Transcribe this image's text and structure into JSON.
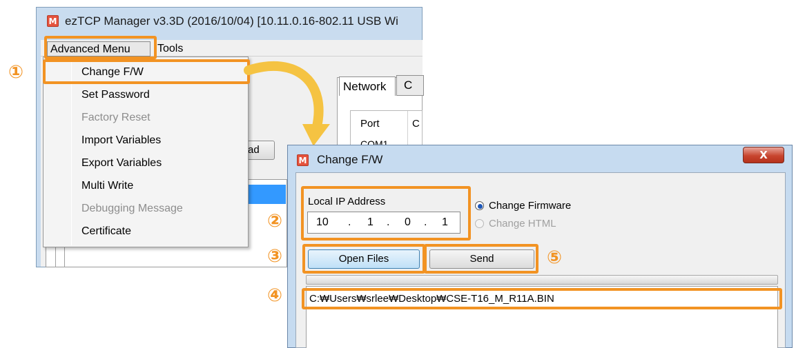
{
  "main_window": {
    "title": "ezTCP Manager v3.3D (2016/10/04) [10.11.0.16-802.11 USB Wi",
    "icon_letter": "M",
    "menu": {
      "advanced": "Advanced Menu",
      "tools": "Tools"
    },
    "tabs": {
      "network": "Network",
      "next_tab_partial": "C"
    },
    "port_column": {
      "header": "Port",
      "header_partial": "C",
      "first_row": "COM1"
    },
    "partial_button": "ad"
  },
  "dropdown_menu": {
    "items": [
      {
        "label": "Change F/W",
        "enabled": true
      },
      {
        "label": "Set Password",
        "enabled": true
      },
      {
        "label": "Factory Reset",
        "enabled": false
      },
      {
        "label": "Import Variables",
        "enabled": true
      },
      {
        "label": "Export Variables",
        "enabled": true
      },
      {
        "label": "Multi Write",
        "enabled": true
      },
      {
        "label": "Debugging Message",
        "enabled": false
      },
      {
        "label": "Certificate",
        "enabled": true
      }
    ]
  },
  "dialog": {
    "title": "Change F/W",
    "icon_letter": "M",
    "close_symbol": "X",
    "local_ip_label": "Local IP Address",
    "ip_octets": [
      "10",
      "1",
      "0",
      "1"
    ],
    "ip_separator": ".",
    "radio_change_firmware": "Change Firmware",
    "radio_change_html": "Change HTML",
    "open_files_button": "Open Files",
    "send_button": "Send",
    "file_path": "C:₩Users₩srlee₩Desktop₩CSE-T16_M_R11A.BIN"
  },
  "annotations": {
    "step1": "①",
    "step2": "②",
    "step3": "③",
    "step4": "④",
    "step5": "⑤",
    "accent_color": "#f29323"
  }
}
